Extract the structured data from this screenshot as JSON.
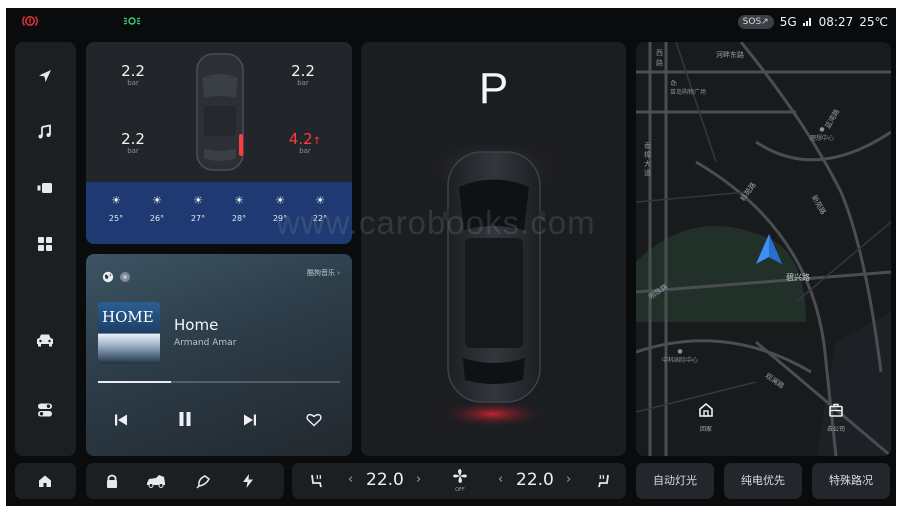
{
  "status": {
    "sos": "SOS",
    "network": "5G",
    "time": "08:27",
    "temperature": "25℃",
    "icons": [
      "brake-warning-icon",
      "parking-light-icon",
      "signal-icon"
    ]
  },
  "sidenav": {
    "items": [
      "navigation-icon",
      "music-icon",
      "camera-icon",
      "apps-icon",
      "car-icon",
      "settings-toggle-icon"
    ]
  },
  "tires": {
    "front_left": {
      "value": "2.2",
      "unit": "bar"
    },
    "front_right": {
      "value": "2.2",
      "unit": "bar"
    },
    "rear_left": {
      "value": "2.2",
      "unit": "bar"
    },
    "rear_right": {
      "value": "4.2",
      "unit": "bar",
      "alert": "↑"
    }
  },
  "weather": {
    "days": [
      {
        "icon": "sun-icon",
        "temp": "25°"
      },
      {
        "icon": "sun-icon",
        "temp": "26°"
      },
      {
        "icon": "sun-icon",
        "temp": "27°"
      },
      {
        "icon": "sun-icon",
        "temp": "28°"
      },
      {
        "icon": "sun-icon",
        "temp": "29°"
      },
      {
        "icon": "sun-icon",
        "temp": "22°"
      }
    ]
  },
  "music": {
    "source": "酷狗音乐",
    "cover_text": "HOME",
    "title": "Home",
    "artist": "Armand Amar",
    "progress": 0.3
  },
  "car": {
    "gear": "P"
  },
  "map": {
    "labels": {
      "road1": "河畔东路",
      "poi1": "苗岛购物广场",
      "road2": "蓝湾路",
      "poi2": "理想中心",
      "road3": "香樟大道",
      "road4": "科苑路",
      "road5": "新苑路",
      "road6": "明珠路",
      "road7": "碧兴路",
      "poi3": "中科国际中心",
      "road8": "观澜路"
    },
    "home_label": "回家",
    "company_label": "去公司"
  },
  "bottom": {
    "left_temp": "22.0",
    "right_temp": "22.0",
    "fan_label": "OFF",
    "quick_buttons": [
      "自动灯光",
      "纯电优先",
      "特殊路况"
    ]
  },
  "watermark": "www.carobooks.com",
  "colors": {
    "accent_blue": "#3d8ff5",
    "alert_red": "#ff3b3b",
    "weather_band": "#1f3a72",
    "light_green": "#37d06d"
  }
}
